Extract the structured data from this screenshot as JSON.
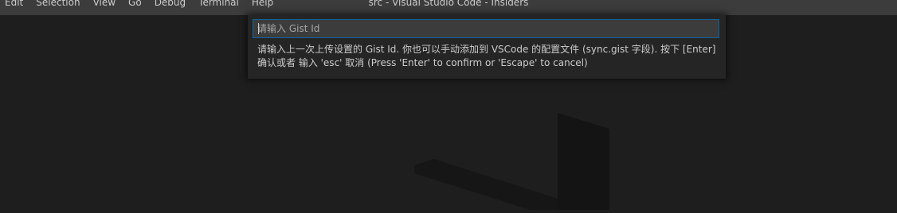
{
  "menubar": {
    "items": [
      "Edit",
      "Selection",
      "View",
      "Go",
      "Debug",
      "Terminal",
      "Help"
    ]
  },
  "window": {
    "title": "src - Visual Studio Code - Insiders"
  },
  "quick_input": {
    "placeholder": "请输入 Gist Id",
    "value": "",
    "message": "请输入上一次上传设置的 Gist Id. 你也可以手动添加到 VSCode 的配置文件 (sync.gist 字段). 按下 [Enter] 确认或者 输入 'esc' 取消 (Press 'Enter' to confirm or 'Escape' to cancel)"
  },
  "colors": {
    "titlebar_bg": "#3c3c3c",
    "editor_bg": "#1e1e1e",
    "widget_bg": "#252526",
    "focus_border": "#0e639c",
    "text": "#cccccc"
  },
  "icons": {
    "watermark": "vscode-logo-icon"
  }
}
